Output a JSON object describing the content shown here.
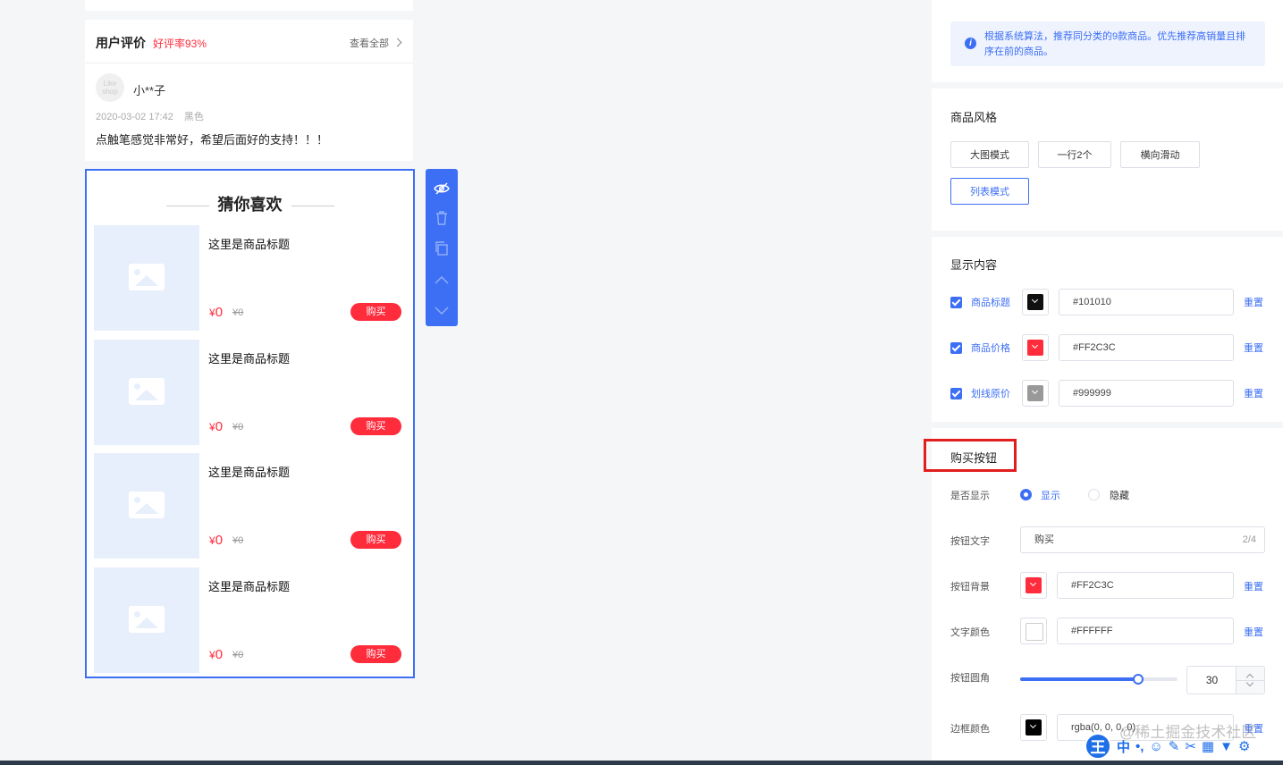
{
  "review": {
    "title": "用户评价",
    "rate": "好评率93%",
    "view_all": "查看全部",
    "avatar_text": "Like shop",
    "reviewer": "小**子",
    "date": "2020-03-02 17:42",
    "spec": "黑色",
    "text": "点触笔感觉非常好，希望后面好的支持！！！"
  },
  "guess": {
    "title": "猜你喜欢",
    "items": [
      {
        "title": "这里是商品标题",
        "price_symbol": "¥",
        "price": "0",
        "origin": "¥0",
        "buy": "购买"
      },
      {
        "title": "这里是商品标题",
        "price_symbol": "¥",
        "price": "0",
        "origin": "¥0",
        "buy": "购买"
      },
      {
        "title": "这里是商品标题",
        "price_symbol": "¥",
        "price": "0",
        "origin": "¥0",
        "buy": "购买"
      },
      {
        "title": "这里是商品标题",
        "price_symbol": "¥",
        "price": "0",
        "origin": "¥0",
        "buy": "购买"
      }
    ]
  },
  "tools": [
    "eye-off-icon",
    "trash-icon",
    "copy-icon",
    "chevron-up-icon",
    "chevron-down-icon"
  ],
  "panel": {
    "tip_text": "根据系统算法，推荐同分类的9款商品。优先推荐高销量且排序在前的商品。",
    "style_section": "商品风格",
    "styles": [
      "大图模式",
      "一行2个",
      "横向滑动",
      "列表模式"
    ],
    "active_style": "列表模式",
    "display_section": "显示内容",
    "display_rows": [
      {
        "label": "商品标题",
        "color": "#101010",
        "reset": "重置"
      },
      {
        "label": "商品价格",
        "color": "#FF2C3C",
        "reset": "重置"
      },
      {
        "label": "划线原价",
        "color": "#999999",
        "reset": "重置"
      }
    ],
    "buy_section": "购买按钮",
    "show_label": "是否显示",
    "show_option": "显示",
    "hide_option": "隐藏",
    "btn_text_label": "按钮文字",
    "btn_text_value": "购买",
    "btn_text_counter": "2/4",
    "btn_bg_label": "按钮背景",
    "btn_bg_value": "#FF2C3C",
    "text_color_label": "文字颜色",
    "text_color_value": "#FFFFFF",
    "radius_label": "按钮圆角",
    "radius_value": "30",
    "radius_fraction": 0.75,
    "border_label": "边框颜色",
    "border_value": "rgba(0, 0, 0, 0)",
    "reset": "重置"
  },
  "overlay": {
    "watermark": "@稀土掘金技术社区",
    "ime_badge": "王",
    "ime_lang": "中"
  },
  "colors": {
    "accent": "#3d6ff5",
    "price_red": "#ff2c3c",
    "title": "#101010",
    "origin_gray": "#999999"
  }
}
